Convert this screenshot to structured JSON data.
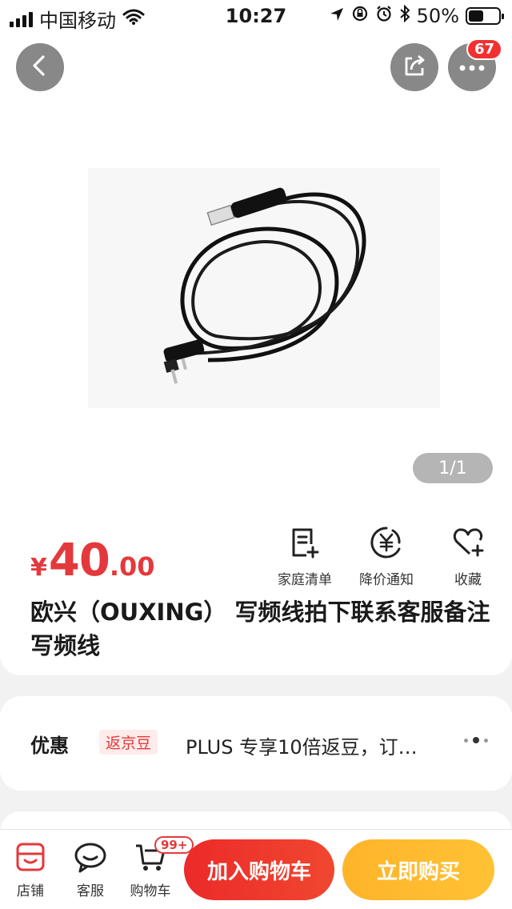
{
  "status_bar": {
    "carrier": "中国移动",
    "time": "10:27",
    "battery_percent": "50%",
    "battery_level": 0.5,
    "icons": [
      "signal-icon",
      "wifi-icon",
      "location-icon",
      "orientation-lock-icon",
      "alarm-icon",
      "bluetooth-icon",
      "battery-icon"
    ]
  },
  "gallery": {
    "back_icon": "chevron-left-icon",
    "share_icon": "share-icon",
    "more_icon": "more-icon",
    "message_badge": "67",
    "counter": "1/1"
  },
  "product": {
    "price_symbol": "¥",
    "price_integer": "40",
    "price_decimal": ".00",
    "title": "欧兴（OUXING） 写频线拍下联系客服备注 写频线",
    "actions": [
      {
        "label": "家庭清单",
        "icon": "list-add-icon"
      },
      {
        "label": "降价通知",
        "icon": "yen-bell-icon"
      },
      {
        "label": "收藏",
        "icon": "heart-add-icon"
      }
    ]
  },
  "promo": {
    "title": "优惠",
    "tag": "返京豆",
    "text": "PLUS 专享10倍返豆，订…"
  },
  "bottom_bar": {
    "items": [
      {
        "label": "店铺",
        "icon": "store-icon"
      },
      {
        "label": "客服",
        "icon": "chat-icon"
      },
      {
        "label": "购物车",
        "icon": "cart-icon"
      }
    ],
    "cart_badge": "99+",
    "add_to_cart": "加入购物车",
    "buy_now": "立即购买"
  },
  "colors": {
    "price_red": "#e4393c",
    "cart_button": "#ec2a2a",
    "buy_button": "#ffb42a",
    "badge_red": "#f23030"
  }
}
